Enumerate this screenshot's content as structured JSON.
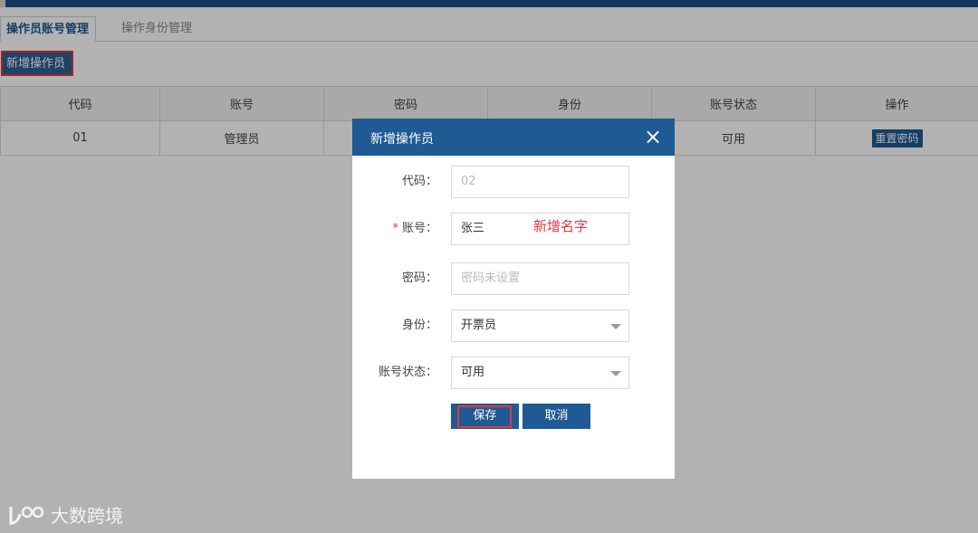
{
  "tabs": [
    {
      "label": "操作员账号管理",
      "active": true
    },
    {
      "label": "操作身份管理",
      "active": false
    }
  ],
  "toolbar": {
    "add_label": "新增操作员"
  },
  "table": {
    "headers": [
      "代码",
      "账号",
      "密码",
      "身份",
      "账号状态",
      "操作"
    ],
    "rows": [
      {
        "code": "01",
        "account": "管理员",
        "password": "",
        "role": "",
        "status": "可用",
        "action": "重置密码"
      }
    ]
  },
  "modal": {
    "title": "新增操作员",
    "close_icon": "close-icon",
    "fields": {
      "code": {
        "label": "代码：",
        "placeholder": "02"
      },
      "account": {
        "required_mark": "*",
        "label": "账号：",
        "value": "张三",
        "annotation": "新增名字"
      },
      "password": {
        "label": "密码：",
        "placeholder": "密码未设置"
      },
      "role": {
        "label": "身份：",
        "value": "开票员"
      },
      "status": {
        "label": "账号状态：",
        "value": "可用"
      }
    },
    "buttons": {
      "save": "保存",
      "cancel": "取消"
    }
  },
  "watermark": {
    "text": "大数跨境"
  },
  "colors": {
    "primary": "#1f5a94",
    "highlight": "#e0393e"
  }
}
